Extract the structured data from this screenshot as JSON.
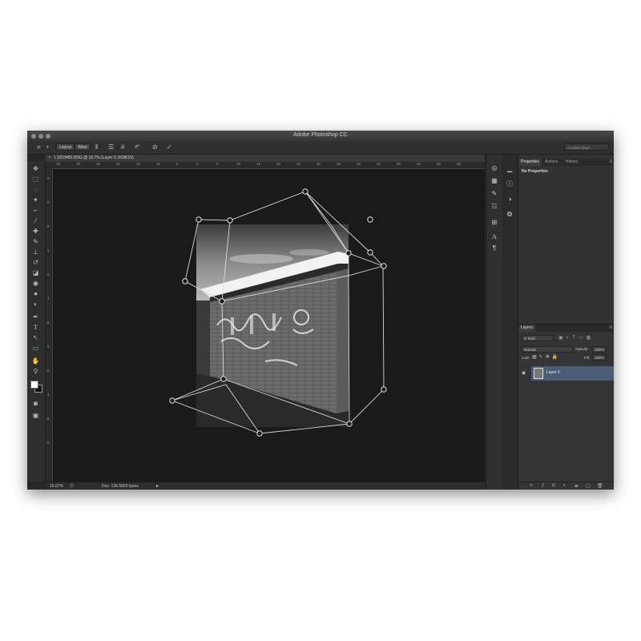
{
  "app": {
    "title": "Adobe Photoshop CC"
  },
  "options_bar": {
    "mode_layout": "Layout",
    "mode_warp": "Warp",
    "icons": [
      "grid-vertical-icon",
      "grid-horizontal-icon",
      "grid-icon",
      "rotate-icon",
      "cancel-icon",
      "commit-icon"
    ],
    "workspace": "Creative Days"
  },
  "document": {
    "tab_title": "L1003485.DNG @ 16.7% (Layer 0, RGB/16)",
    "close_glyph": "×"
  },
  "rulers": {
    "horizontal": [
      "35",
      "30",
      "25",
      "20",
      "15",
      "10",
      "5",
      "0",
      "5",
      "10",
      "15",
      "20",
      "25",
      "30",
      "35",
      "40",
      "45",
      "50",
      "55",
      "60",
      "65"
    ],
    "vertical": [
      "5",
      "0",
      "5",
      "1",
      "5",
      "2",
      "5",
      "3",
      "5",
      "4",
      "5",
      "5"
    ]
  },
  "status": {
    "zoom": "16.67%",
    "doc": "Doc: 136.5M/0 bytes"
  },
  "tools": [
    "move-tool",
    "marquee-tool",
    "lasso-tool",
    "magic-wand-tool",
    "crop-tool",
    "eyedropper-tool",
    "healing-tool",
    "brush-tool",
    "stamp-tool",
    "history-brush-tool",
    "eraser-tool",
    "bucket-tool",
    "blur-tool",
    "dodge-tool",
    "pen-tool",
    "type-tool",
    "path-select-tool",
    "shape-tool",
    "hand-tool",
    "zoom-tool",
    "color-swatches",
    "quick-mask",
    "screen-mode"
  ],
  "properties_panel": {
    "tabs": [
      "Properties",
      "Actions",
      "History"
    ],
    "active_tab": "Properties",
    "content": "No Properties"
  },
  "layers_panel": {
    "tab": "Layers",
    "filter": "Kind",
    "blend_mode": "Normal",
    "opacity_label": "Opacity:",
    "opacity": "100%",
    "lock_label": "Lock:",
    "fill_label": "Fill:",
    "fill": "100%",
    "layers": [
      {
        "name": "Layer 0",
        "selected": true,
        "visible": true
      }
    ]
  },
  "colors": {
    "accent_selection": "#4b5c77",
    "canvas": "#1a1a1a",
    "panel": "#323232"
  }
}
